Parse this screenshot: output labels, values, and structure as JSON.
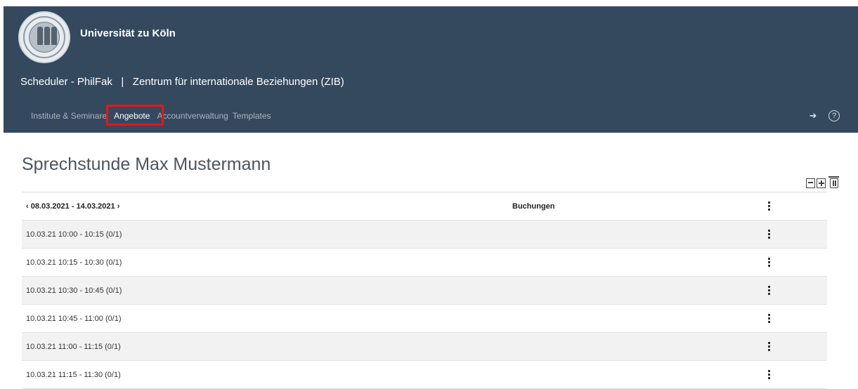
{
  "header": {
    "university_name": "Universität zu Köln",
    "subtitle": "Scheduler - PhilFak   |   Zentrum für internationale Beziehungen (ZIB)",
    "background_color": "#34495e"
  },
  "nav": {
    "items": [
      {
        "label": "Institute & Seminare"
      },
      {
        "label": "Angebote",
        "active": true
      },
      {
        "label": "Accountverwaltung"
      },
      {
        "label": "Templates"
      }
    ],
    "highlight_color": "#e3151a"
  },
  "header_icons": [
    "logout-icon",
    "help-icon"
  ],
  "page": {
    "title": "Sprechstunde Max Mustermann"
  },
  "toolbar": [
    "calendar-icon",
    "calendar-add-icon",
    "trash-icon"
  ],
  "table": {
    "header": {
      "date_prev": "‹",
      "date_range": "08.03.2021 - 14.03.2021",
      "date_next": "›",
      "column_bookings": "Buchungen"
    },
    "rows": [
      {
        "slot": "10.03.21 10:00 - 10:15 (0/1)"
      },
      {
        "slot": "10.03.21 10:15 - 10:30 (0/1)"
      },
      {
        "slot": "10.03.21 10:30 - 10:45 (0/1)"
      },
      {
        "slot": "10.03.21 10:45 - 11:00 (0/1)"
      },
      {
        "slot": "10.03.21 11:00 - 11:15 (0/1)"
      },
      {
        "slot": "10.03.21 11:15 - 11:30 (0/1)"
      }
    ]
  }
}
